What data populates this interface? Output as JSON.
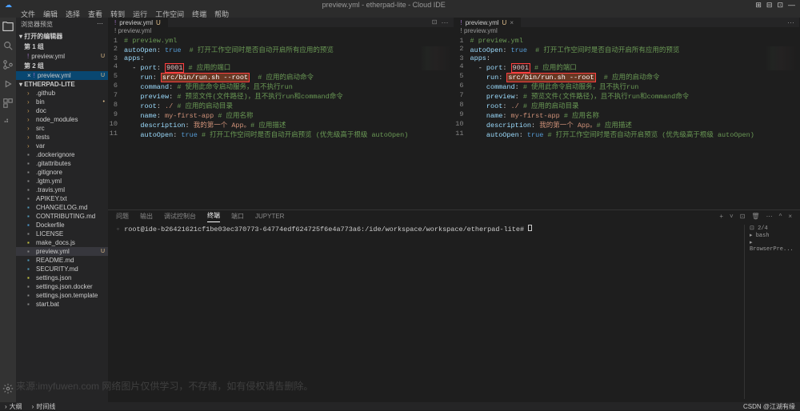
{
  "titlebar": {
    "center": "preview.yml - etherpad-lite - Cloud IDE"
  },
  "menu": [
    "文件",
    "编辑",
    "选择",
    "查看",
    "转到",
    "运行",
    "工作空间",
    "终端",
    "帮助"
  ],
  "sidebar": {
    "header": "浏览器预览",
    "section_open": "打开的编辑器",
    "group1": "第 1 组",
    "group2": "第 2 组",
    "file_preview": "preview.yml",
    "mod_u": "U",
    "project": "ETHERPAD-LITE",
    "items": [
      {
        "name": ".github",
        "type": "folder"
      },
      {
        "name": "bin",
        "type": "folder",
        "mark": "•"
      },
      {
        "name": "doc",
        "type": "folder"
      },
      {
        "name": "node_modules",
        "type": "folder"
      },
      {
        "name": "src",
        "type": "folder"
      },
      {
        "name": "tests",
        "type": "folder"
      },
      {
        "name": "var",
        "type": "folder"
      },
      {
        "name": ".dockerignore",
        "type": "file"
      },
      {
        "name": ".gitattributes",
        "type": "file"
      },
      {
        "name": ".gitignore",
        "type": "file"
      },
      {
        "name": ".lgtm.yml",
        "type": "file"
      },
      {
        "name": ".travis.yml",
        "type": "file"
      },
      {
        "name": "APIKEY.txt",
        "type": "file"
      },
      {
        "name": "CHANGELOG.md",
        "type": "file",
        "color": "#519aba"
      },
      {
        "name": "CONTRIBUTING.md",
        "type": "file",
        "color": "#519aba"
      },
      {
        "name": "Dockerfile",
        "type": "file",
        "color": "#4e9ed6"
      },
      {
        "name": "LICENSE",
        "type": "file"
      },
      {
        "name": "make_docs.js",
        "type": "file",
        "color": "#cbcb41"
      },
      {
        "name": "preview.yml",
        "type": "file",
        "selected": true
      },
      {
        "name": "README.md",
        "type": "file",
        "color": "#519aba"
      },
      {
        "name": "SECURITY.md",
        "type": "file",
        "color": "#519aba"
      },
      {
        "name": "settings.json",
        "type": "file",
        "color": "#cbcb41"
      },
      {
        "name": "settings.json.docker",
        "type": "file"
      },
      {
        "name": "settings.json.template",
        "type": "file"
      },
      {
        "name": "start.bat",
        "type": "file"
      }
    ]
  },
  "editor": {
    "tab": "preview.yml",
    "tab_mod": "U",
    "breadcrumb": "! preview.yml",
    "lines": [
      {
        "n": 1,
        "t": "# preview.yml",
        "cls": "c"
      },
      {
        "n": 2,
        "t": "autoOpen: true  # 打开工作空间时是否自动开启所有应用的预览",
        "k": "autoOpen:",
        "v": "true"
      },
      {
        "n": 3,
        "t": "apps:",
        "k": "apps:"
      },
      {
        "n": 4,
        "t": "  - port: 9001 # 应用的端口",
        "k": "port:",
        "hl1": "9001"
      },
      {
        "n": 5,
        "t": "    run: src/bin/run.sh --root  # 应用的启动命令",
        "k": "run:",
        "hl2": "src/bin/run.sh --root"
      },
      {
        "n": 6,
        "t": "    command: # 使用此命令启动服务，且不执行run",
        "k": "command:"
      },
      {
        "n": 7,
        "t": "    preview: # 预览文件(文件路径)，且不执行run和command命令",
        "k": "preview:"
      },
      {
        "n": 8,
        "t": "    root: ./ # 应用的启动目录",
        "k": "root:"
      },
      {
        "n": 9,
        "t": "    name: my-first-app # 应用名称",
        "k": "name:"
      },
      {
        "n": 10,
        "t": "    description: 我的第一个 App。# 应用描述",
        "k": "description:"
      },
      {
        "n": 11,
        "t": "    autoOpen: true # 打开工作空间时是否自动开启预览 (优先级高于根级 autoOpen)",
        "k": "autoOpen:",
        "v": "true"
      }
    ]
  },
  "panel": {
    "tabs": [
      "问题",
      "输出",
      "调试控制台",
      "终端",
      "端口",
      "JUPYTER"
    ],
    "active_tab": "终端",
    "prompt": "root@ide-b26421621cf1be03ec370773-64774edf624725f6e4a773a6:/ide/workspace/workspace/etherpad-lite#",
    "side": {
      "count": "2/4",
      "items": [
        "bash",
        "BrowserPre..."
      ]
    }
  },
  "status": {
    "branch": "大纲",
    "timeline": "时间线",
    "right": "CSDN @江湖有缘"
  },
  "watermark": "来源:imyfuwen.com 网络图片仅供学习，不存储，如有侵权请告删除。"
}
